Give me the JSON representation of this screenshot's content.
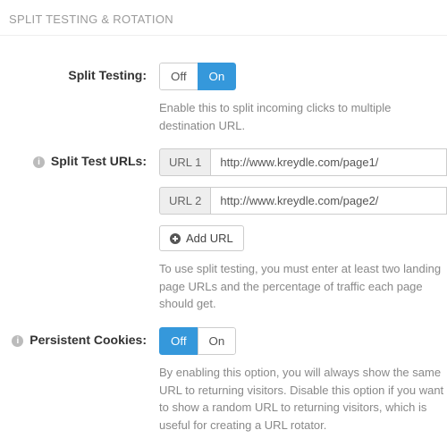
{
  "section": {
    "title": "SPLIT TESTING & ROTATION"
  },
  "splitTesting": {
    "label": "Split Testing:",
    "off": "Off",
    "on": "On",
    "help": "Enable this to split incoming clicks to multiple destination URL."
  },
  "splitUrls": {
    "label": "Split Test URLs:",
    "addon1": "URL 1",
    "value1": "http://www.kreydle.com/page1/",
    "addon2": "URL 2",
    "value2": "http://www.kreydle.com/page2/",
    "addLabel": "Add URL",
    "help": "To use split testing, you must enter at least two landing page URLs and the percentage of traffic each page should get."
  },
  "persistentCookies": {
    "label": "Persistent Cookies:",
    "off": "Off",
    "on": "On",
    "help": "By enabling this option, you will always show the same URL to returning visitors. Disable this option if you want to show a random URL to returning visitors, which is useful for creating a URL rotator."
  }
}
